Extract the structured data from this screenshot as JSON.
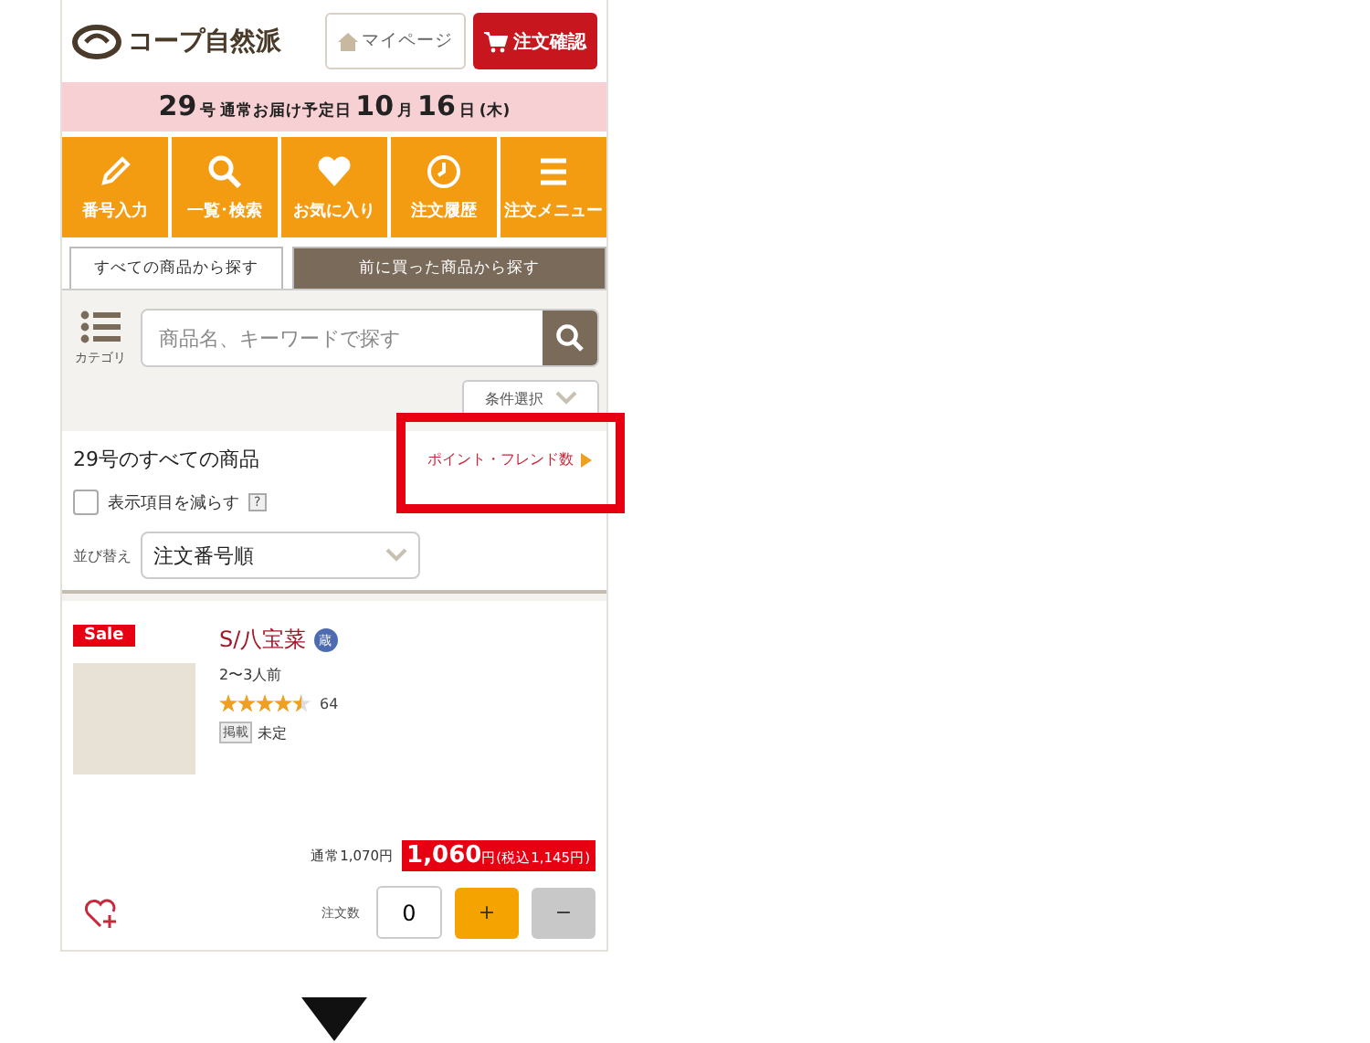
{
  "header": {
    "logo": "コープ自然派",
    "mypage_button": "マイページ",
    "order_button": "注文確認"
  },
  "banner": {
    "issue": "29",
    "issue_unit": "号",
    "label": "通常お届け予定日",
    "month": "10",
    "month_unit": "月",
    "day": "16",
    "day_unit": "日",
    "weekday": "(木)"
  },
  "nav": [
    {
      "kind": "pencil",
      "label": "番号入力"
    },
    {
      "kind": "search",
      "label": "一覧･検索"
    },
    {
      "kind": "heart",
      "label": "お気に入り"
    },
    {
      "kind": "clock",
      "label": "注文履歴"
    },
    {
      "kind": "menu",
      "label": "注文メニュー"
    }
  ],
  "tabs": [
    {
      "label": "すべての商品から探す",
      "selected": true
    },
    {
      "label": "前に買った商品から探す",
      "selected": false
    }
  ],
  "search": {
    "category_label": "カテゴリ",
    "placeholder": "商品名、キーワードで探す",
    "filter_button": "条件選択"
  },
  "list": {
    "title": "29号のすべての商品",
    "points_link": "ポイント・フレンド数",
    "reduce_checkbox": {
      "label": "表示項目を減らす",
      "checked": false,
      "help": "?"
    },
    "sort_label": "並び替え",
    "sort_value": "注文番号順"
  },
  "product": {
    "sale_badge": "Sale",
    "name": "S/八宝菜",
    "storage_badge": "蔵",
    "serving": "2〜3人前",
    "stars": 4.5,
    "review_count": "64",
    "tag": "掲載",
    "tag_value": "未定",
    "regular_price": "通常1,070円",
    "price": "1,060",
    "price_unit": "円(税込1,145円)",
    "quantity_label": "注文数",
    "quantity": "0",
    "plus": "+",
    "minus": "−"
  }
}
